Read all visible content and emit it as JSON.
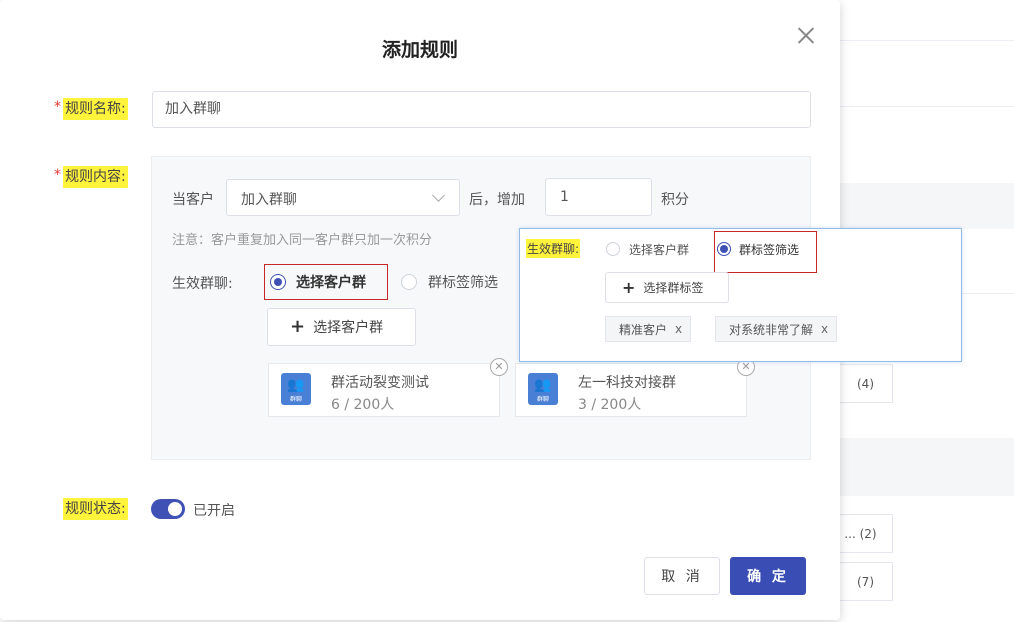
{
  "dialog": {
    "title": "添加规则",
    "rule_name_label": "规则名称:",
    "rule_name_value": "加入群聊",
    "rule_content_label": "规则内容:",
    "when_customer": "当客户",
    "action_select": "加入群聊",
    "after_increase": "后，增加",
    "points_value": "1",
    "points_unit": "积分",
    "note": "注意：客户重复加入同一客户群只加一次积分",
    "effective_group_label": "生效群聊:",
    "radio_select_group": "选择客户群",
    "radio_tag_filter": "群标签筛选",
    "add_group_button": "选择客户群",
    "groups": [
      {
        "name": "群活动裂变测试",
        "count": "6 / 200人",
        "avatar_text": "群聊"
      },
      {
        "name": "左一科技对接群",
        "count": "3 / 200人",
        "avatar_text": "群聊"
      }
    ],
    "rule_status_label": "规则状态:",
    "rule_status_value": "已开启",
    "cancel": "取 消",
    "confirm": "确 定",
    "required_mark": "*"
  },
  "popup": {
    "label": "生效群聊:",
    "radio_select_group": "选择客户群",
    "radio_tag_filter": "群标签筛选",
    "add_tag_button": "选择群标签",
    "tags": [
      {
        "label": "精准客户",
        "remove": "x"
      },
      {
        "label": "对系统非常了解",
        "remove": "x"
      }
    ]
  },
  "background": {
    "counts": [
      "(4)",
      "... (2)",
      "(7)"
    ]
  },
  "colors": {
    "accent": "#3f51b5",
    "primary_button": "#3a4db4",
    "highlight": "#fff33b",
    "required": "#e53935"
  }
}
